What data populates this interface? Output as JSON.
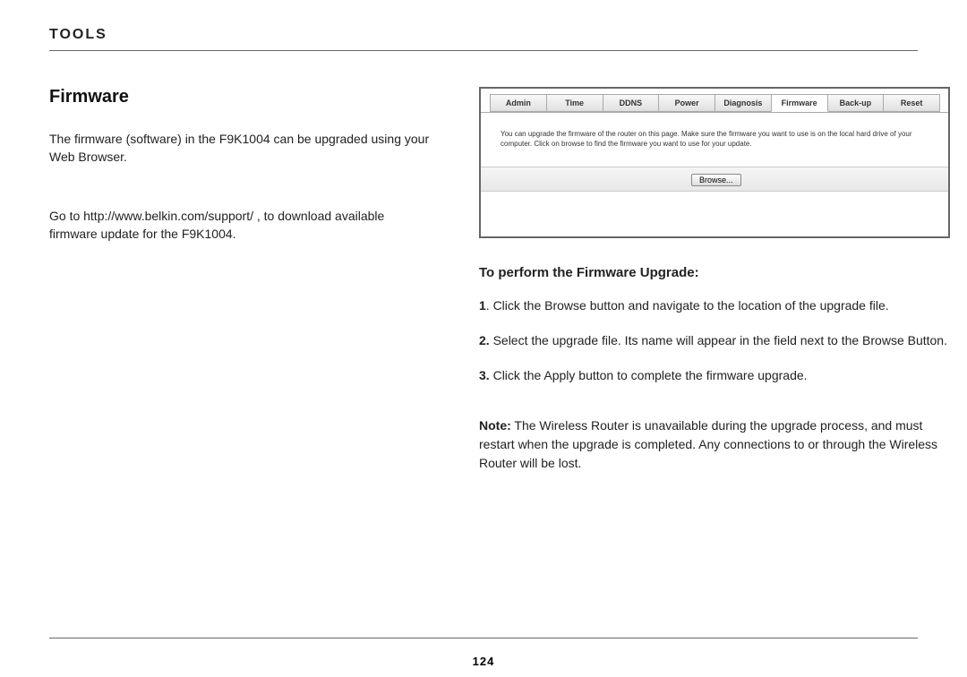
{
  "header": {
    "section": "TOOLS"
  },
  "left": {
    "title": "Firmware",
    "p1": "The firmware (software) in the F9K1004 can be upgraded using your Web Browser.",
    "p2": "Go to http://www.belkin.com/support/ , to download available firmware update for the F9K1004."
  },
  "screenshot": {
    "tabs": [
      "Admin",
      "Time",
      "DDNS",
      "Power",
      "Diagnosis",
      "Firmware",
      "Back-up",
      "Reset"
    ],
    "active_tab_index": 5,
    "body_text": "You can upgrade the firmware of the router on this page. Make sure the firmware you want to use is on the local hard drive of your computer. Click on browse to find the firmware you want to use for your update.",
    "browse_label": "Browse..."
  },
  "steps": {
    "title": "To perform the Firmware Upgrade:",
    "items": [
      {
        "num": "1",
        "text": ". Click the Browse button and navigate to the location of the upgrade file."
      },
      {
        "num": "2.",
        "text": " Select the upgrade file. Its name will appear in the field next to the Browse Button."
      },
      {
        "num": "3.",
        "text": " Click the Apply button to complete the firmware upgrade."
      }
    ],
    "note_label": "Note:",
    "note_text": " The Wireless Router is unavailable during the upgrade process, and must restart when the upgrade is completed. Any connections to or through the Wireless Router will be lost."
  },
  "footer": {
    "page_number": "124"
  }
}
